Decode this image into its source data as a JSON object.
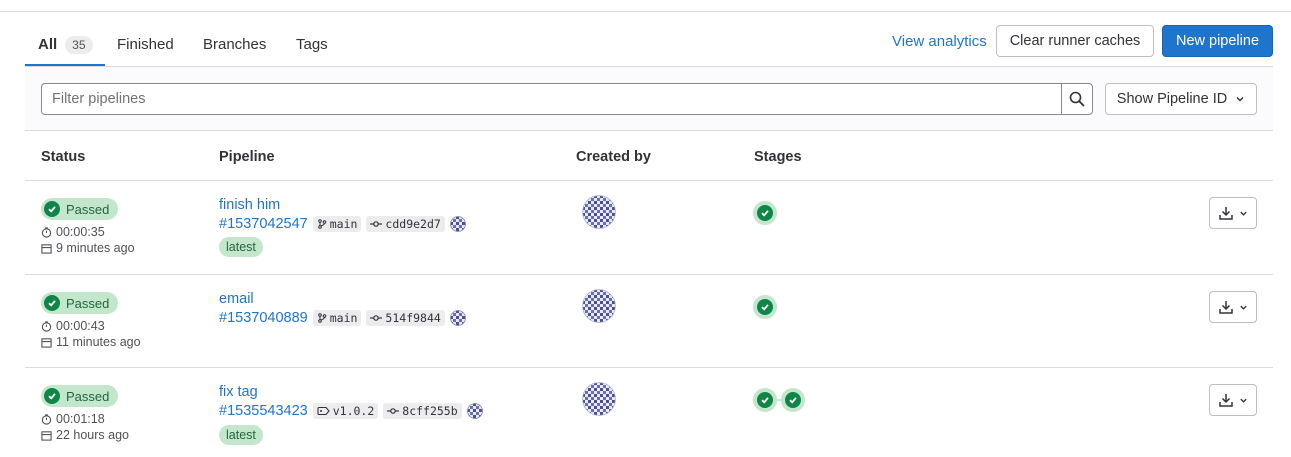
{
  "tabs": {
    "all": {
      "label": "All",
      "count": "35"
    },
    "finished": "Finished",
    "branches": "Branches",
    "tags": "Tags"
  },
  "actions": {
    "view_analytics": "View analytics",
    "clear_caches": "Clear runner caches",
    "new_pipeline": "New pipeline"
  },
  "filter": {
    "placeholder": "Filter pipelines",
    "show_id": "Show Pipeline ID"
  },
  "table": {
    "headers": {
      "status": "Status",
      "pipeline": "Pipeline",
      "created_by": "Created by",
      "stages": "Stages"
    },
    "rows": [
      {
        "status": "Passed",
        "duration": "00:00:35",
        "finished": "9 minutes ago",
        "title": "finish him",
        "id": "#1537042547",
        "ref_type": "branch",
        "ref": "main",
        "commit": "cdd9e2d7",
        "latest": "latest",
        "stages": [
          "passed"
        ]
      },
      {
        "status": "Passed",
        "duration": "00:00:43",
        "finished": "11 minutes ago",
        "title": "email",
        "id": "#1537040889",
        "ref_type": "branch",
        "ref": "main",
        "commit": "514f9844",
        "stages": [
          "passed"
        ]
      },
      {
        "status": "Passed",
        "duration": "00:01:18",
        "finished": "22 hours ago",
        "title": "fix tag",
        "id": "#1535543423",
        "ref_type": "tag",
        "ref": "v1.0.2",
        "commit": "8cff255b",
        "latest": "latest",
        "stages": [
          "passed",
          "passed"
        ]
      }
    ]
  },
  "colors": {
    "accent": "#1f75cb",
    "success": "#108548",
    "success_bg": "#c3e6cd",
    "avatar": "#4b4f8f"
  }
}
